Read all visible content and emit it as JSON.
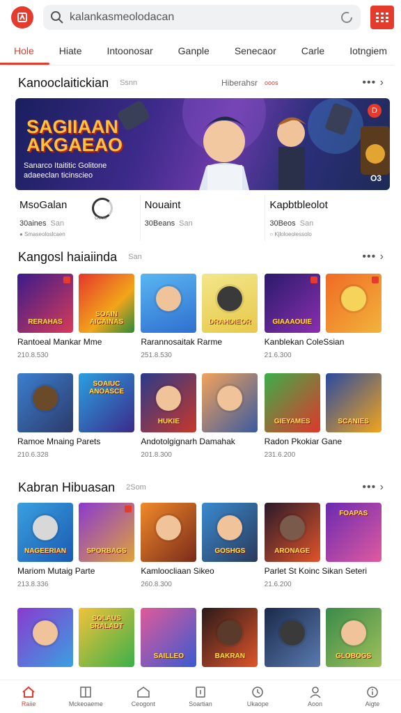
{
  "search": {
    "query": "kalankasmeolodacan"
  },
  "tabs": [
    {
      "label": "Hole",
      "active": true
    },
    {
      "label": "Hiate"
    },
    {
      "label": "Intoonosar"
    },
    {
      "label": "Ganple"
    },
    {
      "label": "Senecaor"
    },
    {
      "label": "Carle"
    },
    {
      "label": "Iotngiem"
    }
  ],
  "featured": {
    "title": "Kanooclaitickian",
    "meta": "Ssnn",
    "mid": "Hiberahsr",
    "red_note": "ooos",
    "more": "•••  ›"
  },
  "banner": {
    "title_line1": "SAGIIAAN",
    "title_line2": "AKGAEAO",
    "sub_line1": "Sanarco Itaititic Golitone",
    "sub_line2": "adaeeclan ticinscieo",
    "badge": "D",
    "page": "O3"
  },
  "stats": [
    {
      "title": "MsoGalan",
      "sub": "30aines",
      "sub_dim": "San",
      "foot": "● Smaseoloslcaen",
      "ring": "Oooo"
    },
    {
      "title": "Nouaint",
      "sub": "30Beans",
      "sub_dim": "San",
      "foot": ""
    },
    {
      "title": "Kapbtbleolot",
      "sub": "30Beos",
      "sub_dim": "San",
      "foot": "○ Kjloloeolessolo"
    }
  ],
  "section2": {
    "title": "Kangosl haiaiinda",
    "meta": "San",
    "more": "•••  ›"
  },
  "section3": {
    "title": "Kabran Hibuasan",
    "meta": "2Som",
    "more": "•••  ›"
  },
  "cards_row1": [
    {
      "title": "Rantoeal Mankar Mme",
      "count": "210.8.530",
      "labels": [
        "RERAHAS",
        "SOAIN AICAINAS"
      ]
    },
    {
      "title": "Rarannosaitak Rarme",
      "count": "251.8.530",
      "labels": [
        "",
        "DRAHDIEOR"
      ]
    },
    {
      "title": "Kanblekan ColeSsian",
      "count": "21.6.300",
      "labels": [
        "GIAAAOUIE",
        ""
      ]
    }
  ],
  "cards_row2": [
    {
      "title": "Ramoe Mnaing Parets",
      "count": "210.6.328",
      "labels": [
        "",
        "SOAIUC ANOASCE"
      ]
    },
    {
      "title": "Andotolgignarh Damahak",
      "count": "201.8.300",
      "labels": [
        "HUKIE",
        ""
      ]
    },
    {
      "title": "Radon Pkokiar Gane",
      "count": "231.6.200",
      "labels": [
        "GIEYAMES",
        "SCANIES"
      ]
    }
  ],
  "cards_row3": [
    {
      "title": "Mariom Mutaig Parte",
      "count": "213.8.336",
      "labels": [
        "NAGEERIAN",
        "SPORBAGS"
      ]
    },
    {
      "title": "Kamloocliaan Sikeo",
      "count": "260.8.300",
      "labels": [
        "",
        "GOSHGS"
      ]
    },
    {
      "title": "Parlet St Koinc Sikan Seteri",
      "count": "21.6.200",
      "labels": [
        "ARONAGE",
        "FOAPAS"
      ]
    }
  ],
  "cards_row4": [
    {
      "title": "",
      "count": "",
      "labels": [
        "",
        "SOLAUS SRALADT"
      ]
    },
    {
      "title": "",
      "count": "",
      "labels": [
        "SAILLEO",
        "BAKRAN"
      ]
    },
    {
      "title": "",
      "count": "",
      "labels": [
        "",
        "GLOBOGS"
      ]
    }
  ],
  "nav": [
    {
      "label": "Raiie",
      "icon": "home-icon",
      "active": true
    },
    {
      "label": "Mckeoaeme",
      "icon": "book-icon"
    },
    {
      "label": "Ceogont",
      "icon": "store-icon"
    },
    {
      "label": "Soartian",
      "icon": "bookmark-icon"
    },
    {
      "label": "Ukaope",
      "icon": "clock-icon"
    },
    {
      "label": "Aoon",
      "icon": "person-icon"
    },
    {
      "label": "Aigte",
      "icon": "info-icon"
    }
  ],
  "colors": {
    "accent": "#e53b2c",
    "text": "#222222",
    "muted": "#999999"
  }
}
